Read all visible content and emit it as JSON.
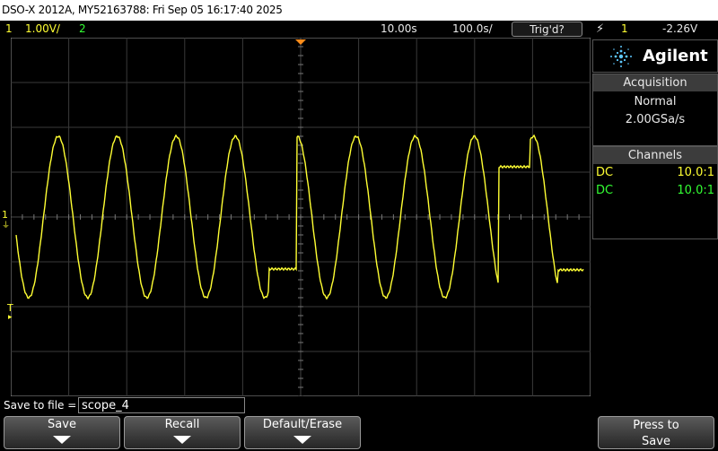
{
  "title": "DSO-X 2012A, MY52163788: Fri Sep 05 16:17:40 2025",
  "status": {
    "ch1_num": "1",
    "ch1_scale": "1.00V/",
    "ch2_num": "2",
    "time_delay": "10.00s",
    "time_scale": "100.0s/",
    "trigger_state": "Trig'd?",
    "trig_source": "1",
    "trig_level": "-2.26V"
  },
  "panel": {
    "brand": "Agilent",
    "acq_header": "Acquisition",
    "acq_mode": "Normal",
    "acq_rate": "2.00GSa/s",
    "ch_header": "Channels",
    "channels": [
      {
        "coupling": "DC",
        "probe": "10.0:1"
      },
      {
        "coupling": "DC",
        "probe": "10.0:1"
      }
    ]
  },
  "markers": {
    "ch1": "1",
    "trigger": "T"
  },
  "save": {
    "label": "Save to file =",
    "filename": "scope_4"
  },
  "softkeys": {
    "save": "Save",
    "recall": "Recall",
    "default_erase": "Default/Erase",
    "press_to": "Press to",
    "save2": "Save"
  },
  "colors": {
    "ch1": "#ffff33",
    "ch2": "#33ff33",
    "grid": "#3a3a3a",
    "trigger_marker": "#ff8c1a"
  }
}
